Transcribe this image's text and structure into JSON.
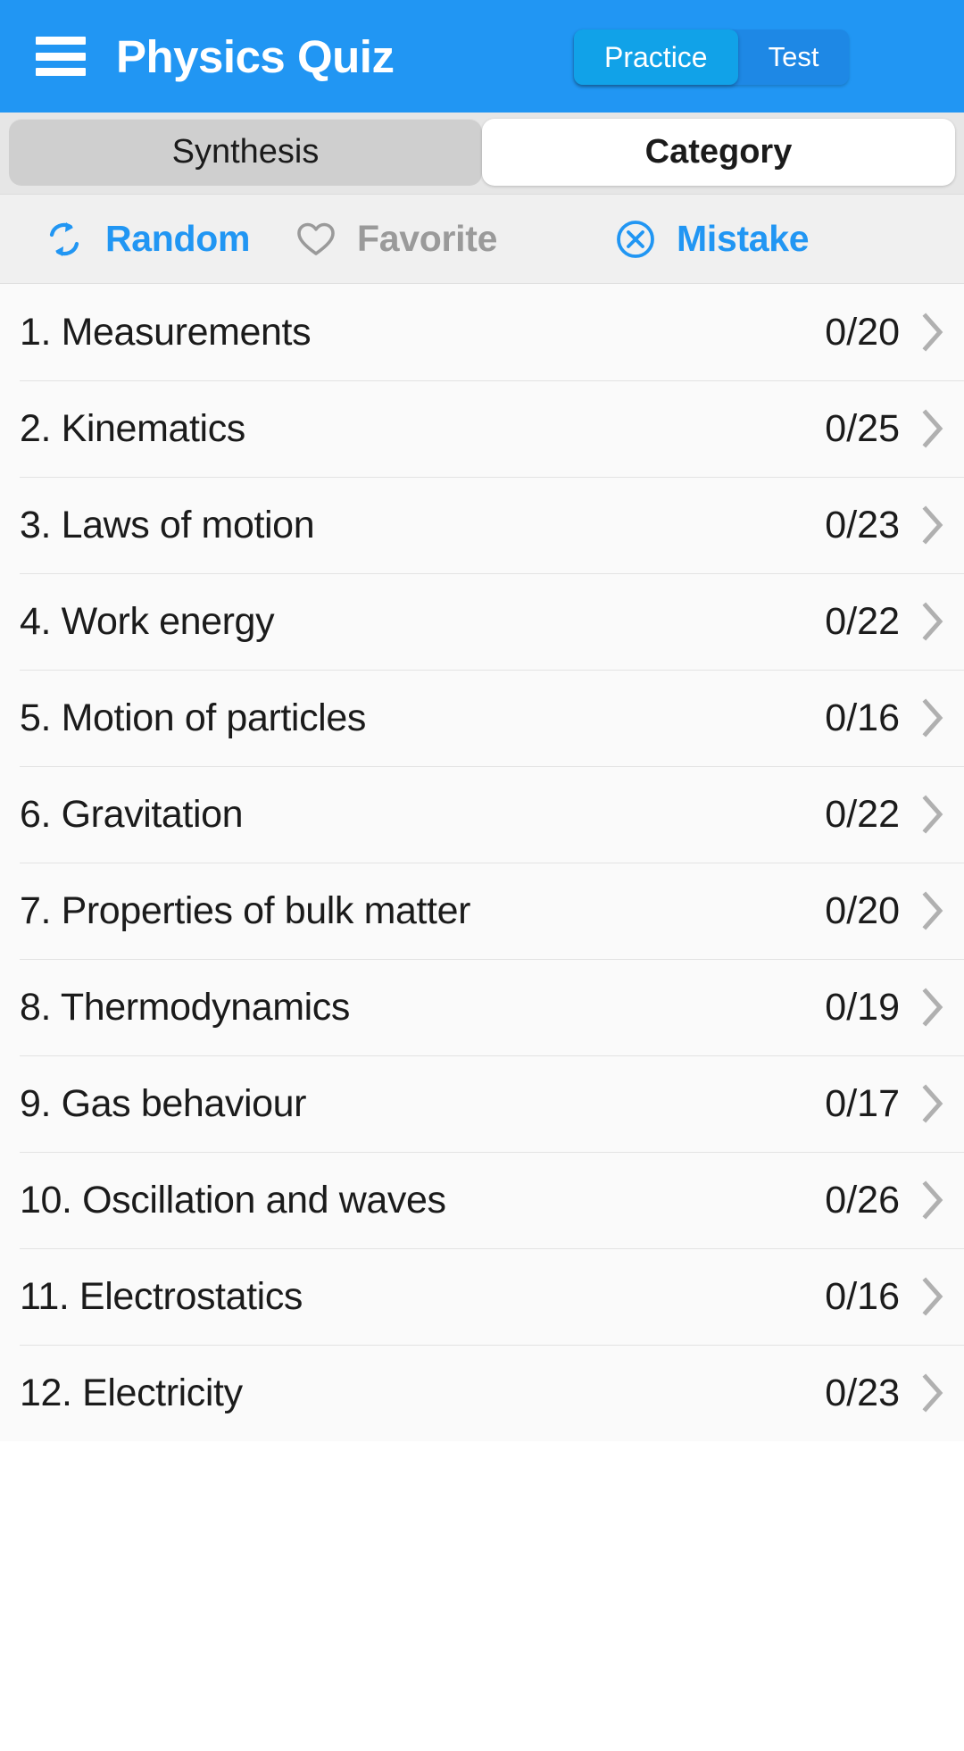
{
  "appbar": {
    "menu_icon": "hamburger-menu-icon",
    "title": "Physics Quiz",
    "modes": [
      {
        "label": "Practice",
        "active": true
      },
      {
        "label": "Test",
        "active": false
      }
    ],
    "background_color": "#2196f3",
    "active_mode_color": "#11a2e8"
  },
  "tabs": [
    {
      "label": "Synthesis",
      "active": false
    },
    {
      "label": "Category",
      "active": true
    }
  ],
  "filters": [
    {
      "label": "Random",
      "icon": "refresh-shuffle-icon",
      "active": true,
      "color": "#2196f3"
    },
    {
      "label": "Favorite",
      "icon": "heart-outline-icon",
      "active": false,
      "color": "#9a9a9a"
    },
    {
      "label": "Mistake",
      "icon": "circle-x-icon",
      "active": true,
      "color": "#2196f3"
    }
  ],
  "list": {
    "chevron_icon": "chevron-right-icon",
    "rows": [
      {
        "title": "1. Measurements",
        "count": "0/20"
      },
      {
        "title": "2. Kinematics",
        "count": "0/25"
      },
      {
        "title": "3. Laws of motion",
        "count": "0/23"
      },
      {
        "title": "4. Work energy",
        "count": "0/22"
      },
      {
        "title": "5. Motion of particles",
        "count": "0/16"
      },
      {
        "title": "6. Gravitation",
        "count": "0/22"
      },
      {
        "title": "7. Properties of bulk matter",
        "count": "0/20"
      },
      {
        "title": "8. Thermodynamics",
        "count": "0/19"
      },
      {
        "title": "9. Gas behaviour",
        "count": "0/17"
      },
      {
        "title": "10. Oscillation and waves",
        "count": "0/26"
      },
      {
        "title": "11. Electrostatics",
        "count": "0/16"
      },
      {
        "title": "12. Electricity",
        "count": "0/23"
      }
    ]
  }
}
